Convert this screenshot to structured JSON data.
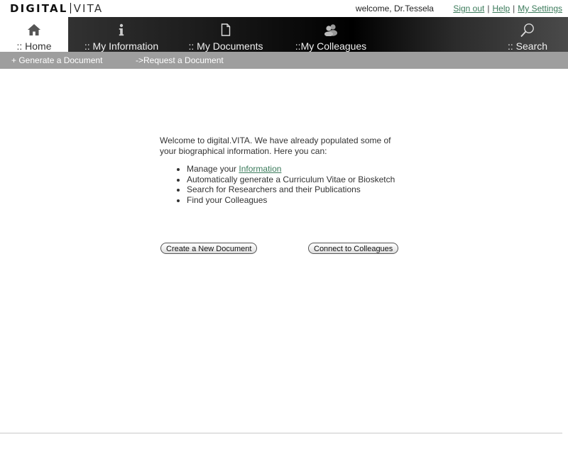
{
  "header": {
    "logo_bold": "DIGITAL",
    "logo_light": "VITA",
    "welcome": "welcome, Dr.Tessela",
    "signout": "Sign out",
    "help": "Help",
    "settings": "My Settings",
    "separator": "|"
  },
  "nav": {
    "tabs": [
      {
        "label": ":: Home",
        "icon": "home-icon",
        "active": true
      },
      {
        "label": ":: My Information",
        "icon": "info-icon",
        "active": false
      },
      {
        "label": ":: My Documents",
        "icon": "document-icon",
        "active": false
      },
      {
        "label": "::My Colleagues",
        "icon": "colleagues-icon",
        "active": false
      },
      {
        "label": ":: Search",
        "icon": "search-icon",
        "active": false
      }
    ]
  },
  "subnav": {
    "generate": "+ Generate a Document",
    "request": "->Request a Document"
  },
  "main": {
    "intro": "Welcome to digital.VITA. We have already populated some of your biographical information. Here you can:",
    "bullets": {
      "manage_prefix": "Manage your ",
      "manage_link": "Information",
      "generate": "Automatically generate a Curriculum Vitae or Biosketch",
      "search": "Search for Researchers and their Publications",
      "colleagues": "Find your Colleagues"
    },
    "create_button": "Create a New Document",
    "connect_button": "Connect to Colleagues"
  },
  "colors": {
    "link": "#3a7a5a",
    "subbar": "#9e9e9e",
    "nav_dark": "#000000"
  }
}
